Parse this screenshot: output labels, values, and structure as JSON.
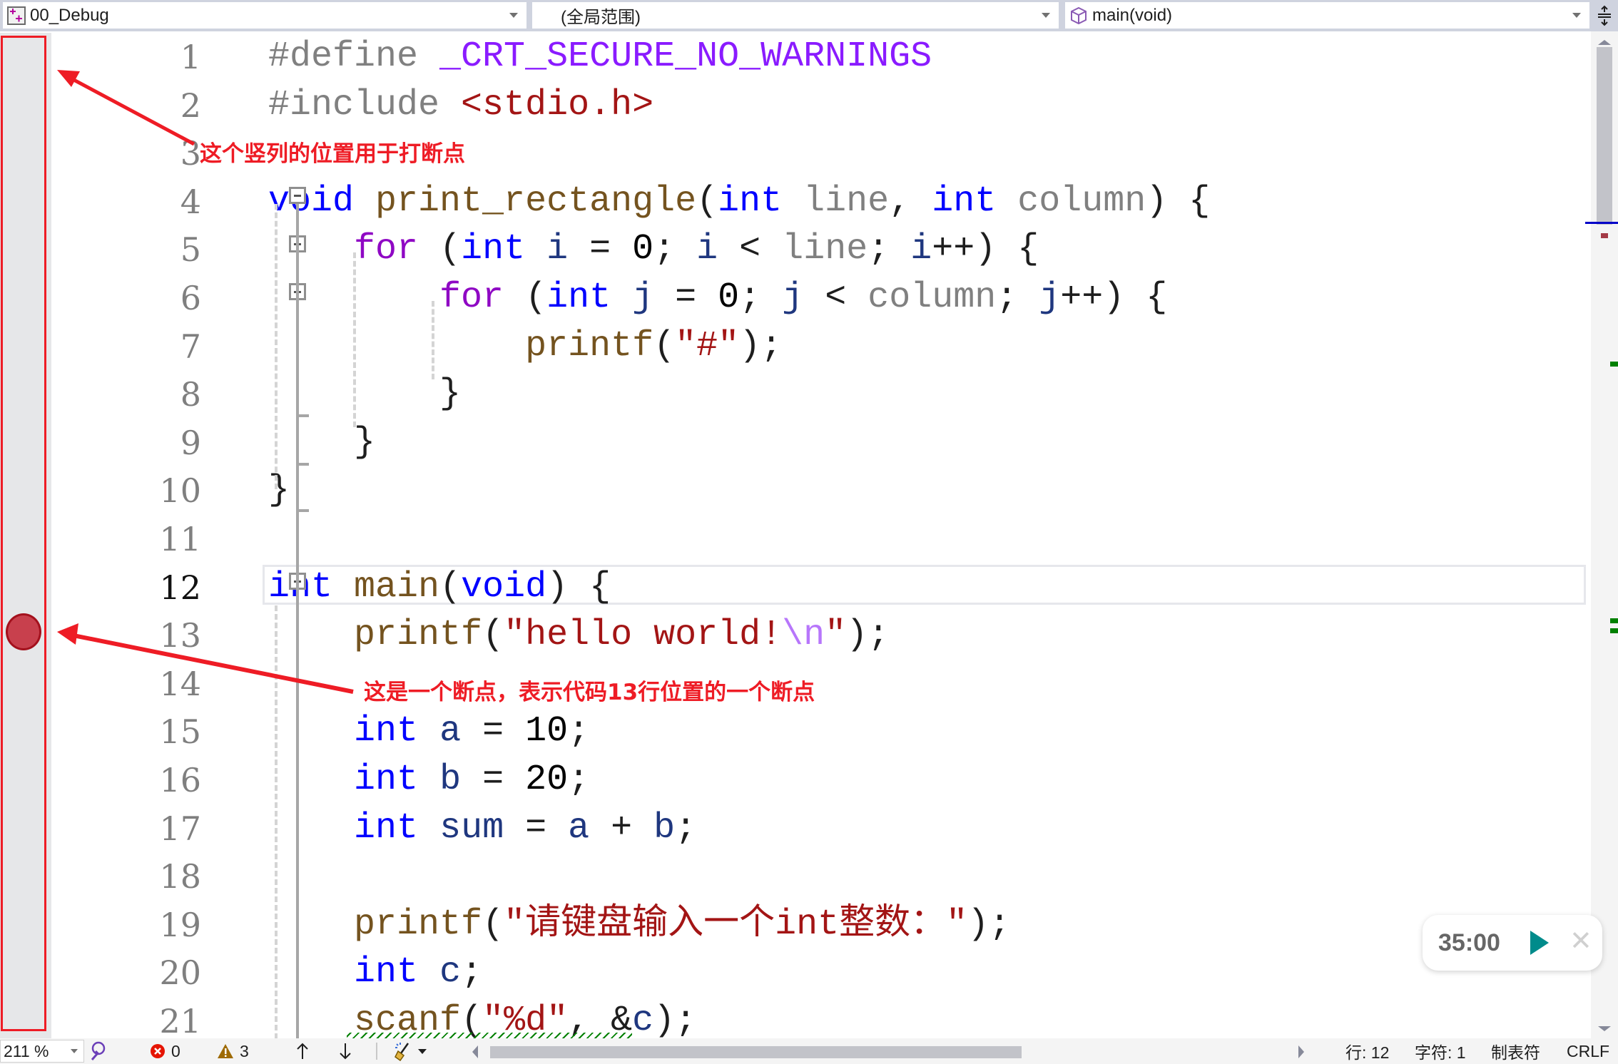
{
  "toolbar": {
    "project_dropdown": {
      "value": "00_Debug",
      "icon": "project-icon"
    },
    "scope_dropdown": {
      "value": "(全局范围)"
    },
    "member_dropdown": {
      "value": "main(void)",
      "icon": "function-cube-icon"
    },
    "splitter_icon": "split-window-icon"
  },
  "editor": {
    "current_line": 12,
    "breakpoint_line": 13,
    "line_numbers": [
      "1",
      "2",
      "3",
      "4",
      "5",
      "6",
      "7",
      "8",
      "9",
      "10",
      "11",
      "12",
      "13",
      "14",
      "15",
      "16",
      "17",
      "18",
      "19",
      "20",
      "21"
    ],
    "lines": [
      [
        {
          "t": "#define ",
          "c": "pp"
        },
        {
          "t": "_CRT_SECURE_NO_WARNINGS",
          "c": "mac"
        }
      ],
      [
        {
          "t": "#include ",
          "c": "pp"
        },
        {
          "t": "<stdio.h>",
          "c": "str"
        }
      ],
      [],
      [
        {
          "t": "void ",
          "c": "k"
        },
        {
          "t": "print_rectangle",
          "c": "fn"
        },
        {
          "t": "(",
          "c": ""
        },
        {
          "t": "int ",
          "c": "k"
        },
        {
          "t": "line",
          "c": "prm"
        },
        {
          "t": ", ",
          "c": ""
        },
        {
          "t": "int ",
          "c": "k"
        },
        {
          "t": "column",
          "c": "prm"
        },
        {
          "t": ") {",
          "c": ""
        }
      ],
      [
        {
          "t": "    ",
          "c": ""
        },
        {
          "t": "for",
          "c": "ctl"
        },
        {
          "t": " (",
          "c": ""
        },
        {
          "t": "int ",
          "c": "k"
        },
        {
          "t": "i",
          "c": "var"
        },
        {
          "t": " = ",
          "c": ""
        },
        {
          "t": "0",
          "c": "num"
        },
        {
          "t": "; ",
          "c": ""
        },
        {
          "t": "i",
          "c": "var"
        },
        {
          "t": " < ",
          "c": ""
        },
        {
          "t": "line",
          "c": "prm"
        },
        {
          "t": "; ",
          "c": ""
        },
        {
          "t": "i",
          "c": "var"
        },
        {
          "t": "++) {",
          "c": ""
        }
      ],
      [
        {
          "t": "        ",
          "c": ""
        },
        {
          "t": "for",
          "c": "ctl"
        },
        {
          "t": " (",
          "c": ""
        },
        {
          "t": "int ",
          "c": "k"
        },
        {
          "t": "j",
          "c": "var"
        },
        {
          "t": " = ",
          "c": ""
        },
        {
          "t": "0",
          "c": "num"
        },
        {
          "t": "; ",
          "c": ""
        },
        {
          "t": "j",
          "c": "var"
        },
        {
          "t": " < ",
          "c": ""
        },
        {
          "t": "column",
          "c": "prm"
        },
        {
          "t": "; ",
          "c": ""
        },
        {
          "t": "j",
          "c": "var"
        },
        {
          "t": "++) {",
          "c": ""
        }
      ],
      [
        {
          "t": "            ",
          "c": ""
        },
        {
          "t": "printf",
          "c": "fn"
        },
        {
          "t": "(",
          "c": ""
        },
        {
          "t": "\"#\"",
          "c": "str"
        },
        {
          "t": ");",
          "c": ""
        }
      ],
      [
        {
          "t": "        }",
          "c": ""
        }
      ],
      [
        {
          "t": "    }",
          "c": ""
        }
      ],
      [
        {
          "t": "}",
          "c": ""
        }
      ],
      [],
      [
        {
          "t": "int ",
          "c": "k"
        },
        {
          "t": "main",
          "c": "fn"
        },
        {
          "t": "(",
          "c": ""
        },
        {
          "t": "void",
          "c": "k"
        },
        {
          "t": ") {",
          "c": ""
        }
      ],
      [
        {
          "t": "    ",
          "c": ""
        },
        {
          "t": "printf",
          "c": "fn"
        },
        {
          "t": "(",
          "c": ""
        },
        {
          "t": "\"hello world!",
          "c": "str"
        },
        {
          "t": "\\n",
          "c": "esc"
        },
        {
          "t": "\"",
          "c": "str"
        },
        {
          "t": ");",
          "c": ""
        }
      ],
      [],
      [
        {
          "t": "    ",
          "c": ""
        },
        {
          "t": "int ",
          "c": "k"
        },
        {
          "t": "a",
          "c": "var"
        },
        {
          "t": " = ",
          "c": ""
        },
        {
          "t": "10",
          "c": "num"
        },
        {
          "t": ";",
          "c": ""
        }
      ],
      [
        {
          "t": "    ",
          "c": ""
        },
        {
          "t": "int ",
          "c": "k"
        },
        {
          "t": "b",
          "c": "var"
        },
        {
          "t": " = ",
          "c": ""
        },
        {
          "t": "20",
          "c": "num"
        },
        {
          "t": ";",
          "c": ""
        }
      ],
      [
        {
          "t": "    ",
          "c": ""
        },
        {
          "t": "int ",
          "c": "k"
        },
        {
          "t": "sum",
          "c": "var"
        },
        {
          "t": " = ",
          "c": ""
        },
        {
          "t": "a",
          "c": "var"
        },
        {
          "t": " + ",
          "c": ""
        },
        {
          "t": "b",
          "c": "var"
        },
        {
          "t": ";",
          "c": ""
        }
      ],
      [],
      [
        {
          "t": "    ",
          "c": ""
        },
        {
          "t": "printf",
          "c": "fn"
        },
        {
          "t": "(",
          "c": ""
        },
        {
          "t": "\"请键盘输入一个int整数：\"",
          "c": "str"
        },
        {
          "t": ");",
          "c": ""
        }
      ],
      [
        {
          "t": "    ",
          "c": ""
        },
        {
          "t": "int ",
          "c": "k"
        },
        {
          "t": "c",
          "c": "var"
        },
        {
          "t": ";",
          "c": ""
        }
      ],
      [
        {
          "t": "    ",
          "c": ""
        },
        {
          "t": "scanf",
          "c": "fn"
        },
        {
          "t": "(",
          "c": ""
        },
        {
          "t": "\"%d\"",
          "c": "str"
        },
        {
          "t": ", &",
          "c": ""
        },
        {
          "t": "c",
          "c": "var"
        },
        {
          "t": ");",
          "c": ""
        }
      ]
    ]
  },
  "annotations": {
    "gutter_note": "这个竖列的位置用于打断点",
    "breakpoint_note": "这是一个断点，表示代码13行位置的一个断点",
    "color": "#ee1c25"
  },
  "timer": {
    "time": "35:00",
    "play_icon": "play-icon",
    "close_icon": "close-icon",
    "accent": "#008b8b"
  },
  "status_bar": {
    "zoom": "211 %",
    "errors": "0",
    "warnings": "3",
    "line": "行: 12",
    "char": "字符: 1",
    "indent": "制表符",
    "line_ending": "CRLF"
  }
}
